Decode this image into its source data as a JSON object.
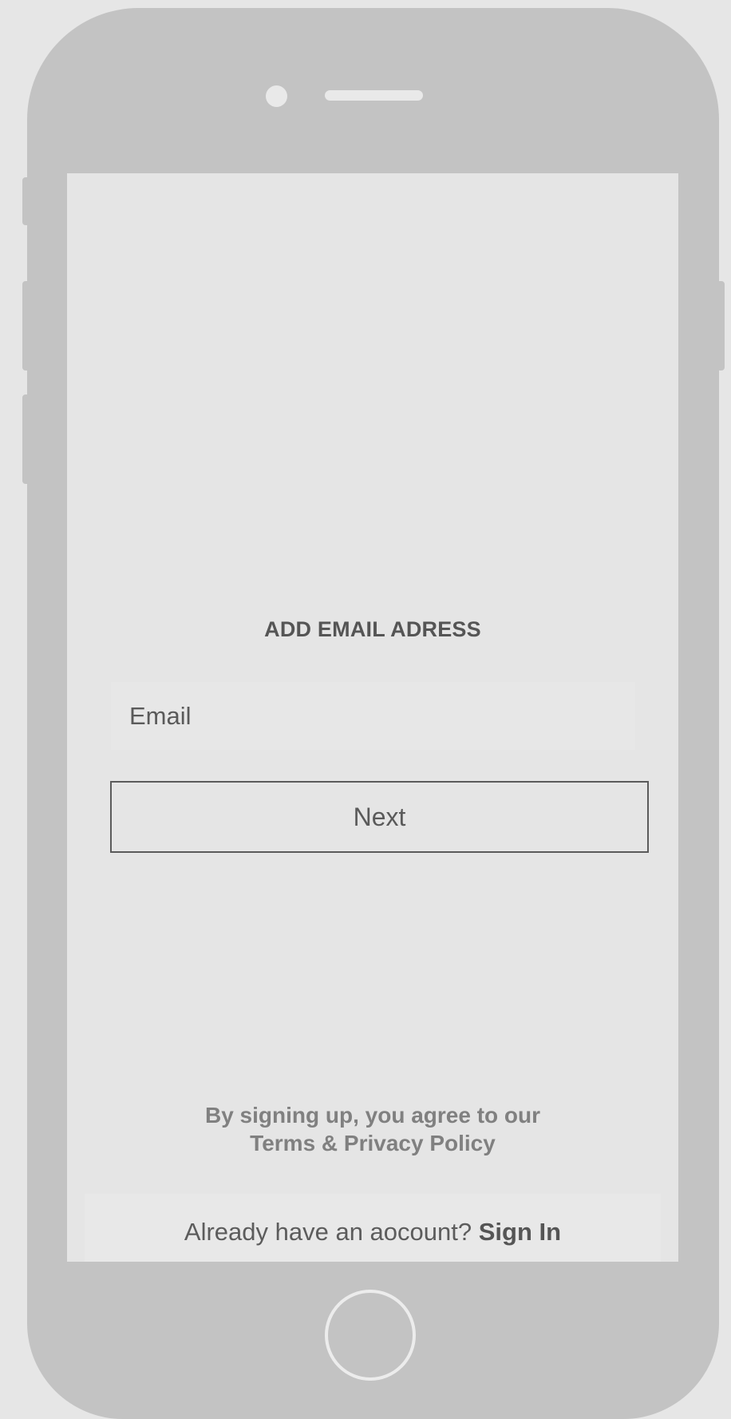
{
  "screen": {
    "title": "ADD EMAIL ADRESS",
    "email_placeholder": "Email",
    "email_value": "",
    "next_label": "Next",
    "terms_line1": "By signing up, you agree to our",
    "terms_line2": "Terms & Privacy Policy",
    "signin_prompt": "Already have an aocount?",
    "signin_link": "Sign In"
  },
  "colors": {
    "page_background": "#e6e6e6",
    "phone_frame": "#c3c3c3",
    "screen_background": "#e5e5e5",
    "text_dark": "#555555",
    "text_muted": "#808080"
  }
}
